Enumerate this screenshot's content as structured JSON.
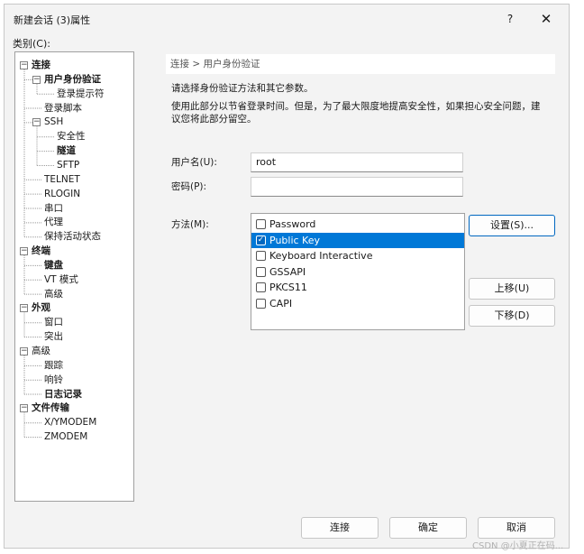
{
  "window": {
    "title": "新建会话 (3)属性",
    "help": "?",
    "close": "✕"
  },
  "category_label": "类别(C):",
  "tree": [
    {
      "label": "连接",
      "bold": true,
      "level": 0,
      "expander": "−"
    },
    {
      "label": "用户身份验证",
      "bold": true,
      "level": 1,
      "expander": "−"
    },
    {
      "label": "登录提示符",
      "bold": false,
      "level": 2
    },
    {
      "label": "登录脚本",
      "bold": false,
      "level": 1
    },
    {
      "label": "SSH",
      "bold": false,
      "level": 1,
      "expander": "−"
    },
    {
      "label": "安全性",
      "bold": false,
      "level": 2
    },
    {
      "label": "隧道",
      "bold": true,
      "level": 2
    },
    {
      "label": "SFTP",
      "bold": false,
      "level": 2
    },
    {
      "label": "TELNET",
      "bold": false,
      "level": 1
    },
    {
      "label": "RLOGIN",
      "bold": false,
      "level": 1
    },
    {
      "label": "串口",
      "bold": false,
      "level": 1
    },
    {
      "label": "代理",
      "bold": false,
      "level": 1
    },
    {
      "label": "保持活动状态",
      "bold": false,
      "level": 1
    },
    {
      "label": "终端",
      "bold": true,
      "level": 0,
      "expander": "−"
    },
    {
      "label": "键盘",
      "bold": true,
      "level": 1
    },
    {
      "label": "VT 模式",
      "bold": false,
      "level": 1
    },
    {
      "label": "高级",
      "bold": false,
      "level": 1
    },
    {
      "label": "外观",
      "bold": true,
      "level": 0,
      "expander": "−"
    },
    {
      "label": "窗口",
      "bold": false,
      "level": 1
    },
    {
      "label": "突出",
      "bold": false,
      "level": 1
    },
    {
      "label": "高级",
      "bold": false,
      "level": 0,
      "expander": "−"
    },
    {
      "label": "跟踪",
      "bold": false,
      "level": 1
    },
    {
      "label": "响铃",
      "bold": false,
      "level": 1
    },
    {
      "label": "日志记录",
      "bold": true,
      "level": 1
    },
    {
      "label": "文件传输",
      "bold": true,
      "level": 0,
      "expander": "−"
    },
    {
      "label": "X/YMODEM",
      "bold": false,
      "level": 1
    },
    {
      "label": "ZMODEM",
      "bold": false,
      "level": 1
    }
  ],
  "panel": {
    "breadcrumb": "连接 > 用户身份验证",
    "intro": "请选择身份验证方法和其它参数。",
    "desc_line1": "使用此部分以节省登录时间。但是，为了最大限度地提高安全性，如果担心安全问题，建",
    "desc_line2": "议您将此部分留空。",
    "username_label": "用户名(U):",
    "username_value": "root",
    "password_label": "密码(P):",
    "password_value": "",
    "method_label": "方法(M):",
    "methods": [
      {
        "label": "Password",
        "checked": false,
        "selected": false
      },
      {
        "label": "Public Key",
        "checked": true,
        "selected": true
      },
      {
        "label": "Keyboard Interactive",
        "checked": false,
        "selected": false
      },
      {
        "label": "GSSAPI",
        "checked": false,
        "selected": false
      },
      {
        "label": "PKCS11",
        "checked": false,
        "selected": false
      },
      {
        "label": "CAPI",
        "checked": false,
        "selected": false
      }
    ],
    "settings_button": "设置(S)...",
    "move_up_button": "上移(U)",
    "move_down_button": "下移(D)"
  },
  "footer": {
    "connect": "连接",
    "ok": "确定",
    "cancel": "取消"
  },
  "watermark": "CSDN @小夏正在码..."
}
